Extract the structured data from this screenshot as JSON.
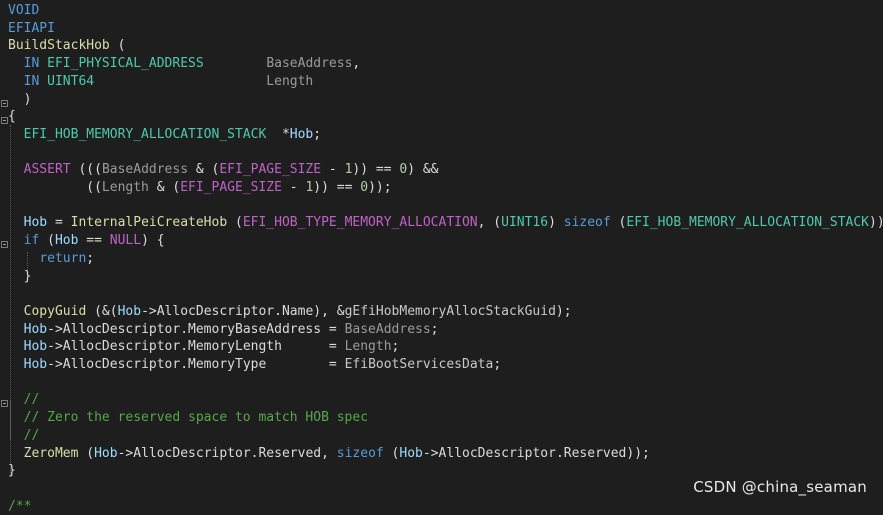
{
  "code": {
    "lines": [
      [
        [
          "VOID",
          "t-kw"
        ]
      ],
      [
        [
          "EFIAPI",
          "t-kw"
        ]
      ],
      [
        [
          "BuildStackHob",
          "t-fn"
        ],
        [
          " (",
          "t-pl"
        ]
      ],
      [
        [
          "  IN ",
          "t-kw"
        ],
        [
          "EFI_PHYSICAL_ADDRESS",
          "t-ty"
        ],
        [
          "        ",
          "t-pl"
        ],
        [
          "BaseAddress",
          "t-par"
        ],
        [
          ",",
          "t-pl"
        ]
      ],
      [
        [
          "  IN ",
          "t-kw"
        ],
        [
          "UINT64",
          "t-ty"
        ],
        [
          "                      ",
          "t-pl"
        ],
        [
          "Length",
          "t-par"
        ]
      ],
      [
        [
          "  )",
          "t-pl"
        ]
      ],
      [
        [
          "{",
          "t-pl"
        ]
      ],
      [
        [
          "  ",
          "t-pl"
        ],
        [
          "EFI_HOB_MEMORY_ALLOCATION_STACK",
          "t-ty"
        ],
        [
          "  *",
          "t-pl"
        ],
        [
          "Hob",
          "t-var"
        ],
        [
          ";",
          "t-pl"
        ]
      ],
      [
        [
          "",
          "t-pl"
        ]
      ],
      [
        [
          "  ASSERT",
          "t-mac"
        ],
        [
          " (((",
          "t-pl"
        ],
        [
          "BaseAddress",
          "t-par"
        ],
        [
          " & (",
          "t-pl"
        ],
        [
          "EFI_PAGE_SIZE",
          "t-mac"
        ],
        [
          " - ",
          "t-pl"
        ],
        [
          "1",
          "t-num"
        ],
        [
          ")) == ",
          "t-pl"
        ],
        [
          "0",
          "t-num"
        ],
        [
          ") &&",
          "t-pl"
        ]
      ],
      [
        [
          "          ((",
          "t-pl"
        ],
        [
          "Length",
          "t-par"
        ],
        [
          " & (",
          "t-pl"
        ],
        [
          "EFI_PAGE_SIZE",
          "t-mac"
        ],
        [
          " - ",
          "t-pl"
        ],
        [
          "1",
          "t-num"
        ],
        [
          ")) == ",
          "t-pl"
        ],
        [
          "0",
          "t-num"
        ],
        [
          "));",
          "t-pl"
        ]
      ],
      [
        [
          "",
          "t-pl"
        ]
      ],
      [
        [
          "  ",
          "t-pl"
        ],
        [
          "Hob",
          "t-var"
        ],
        [
          " = ",
          "t-pl"
        ],
        [
          "InternalPeiCreateHob",
          "t-fn"
        ],
        [
          " (",
          "t-pl"
        ],
        [
          "EFI_HOB_TYPE_MEMORY_ALLOCATION",
          "t-mac"
        ],
        [
          ", (",
          "t-pl"
        ],
        [
          "UINT16",
          "t-ty"
        ],
        [
          ") ",
          "t-pl"
        ],
        [
          "sizeof",
          "t-kw"
        ],
        [
          " (",
          "t-pl"
        ],
        [
          "EFI_HOB_MEMORY_ALLOCATION_STACK",
          "t-ty"
        ],
        [
          "));",
          "t-pl"
        ]
      ],
      [
        [
          "  ",
          "t-pl"
        ],
        [
          "if",
          "t-kw"
        ],
        [
          " (",
          "t-pl"
        ],
        [
          "Hob",
          "t-var"
        ],
        [
          " == ",
          "t-pl"
        ],
        [
          "NULL",
          "t-mac"
        ],
        [
          ") {",
          "t-pl"
        ]
      ],
      [
        [
          "    ",
          "t-pl"
        ],
        [
          "return",
          "t-kw"
        ],
        [
          ";",
          "t-pl"
        ]
      ],
      [
        [
          "  }",
          "t-pl"
        ]
      ],
      [
        [
          "",
          "t-pl"
        ]
      ],
      [
        [
          "  ",
          "t-pl"
        ],
        [
          "CopyGuid",
          "t-fn"
        ],
        [
          " (&(",
          "t-pl"
        ],
        [
          "Hob",
          "t-var"
        ],
        [
          "->",
          "t-pl"
        ],
        [
          "AllocDescriptor",
          "t-mem"
        ],
        [
          ".",
          "t-pl"
        ],
        [
          "Name",
          "t-mem"
        ],
        [
          "), &",
          "t-pl"
        ],
        [
          "gEfiHobMemoryAllocStackGuid",
          "t-glb"
        ],
        [
          ");",
          "t-pl"
        ]
      ],
      [
        [
          "  ",
          "t-pl"
        ],
        [
          "Hob",
          "t-var"
        ],
        [
          "->",
          "t-pl"
        ],
        [
          "AllocDescriptor",
          "t-mem"
        ],
        [
          ".",
          "t-pl"
        ],
        [
          "MemoryBaseAddress",
          "t-mem"
        ],
        [
          " = ",
          "t-pl"
        ],
        [
          "BaseAddress",
          "t-par"
        ],
        [
          ";",
          "t-pl"
        ]
      ],
      [
        [
          "  ",
          "t-pl"
        ],
        [
          "Hob",
          "t-var"
        ],
        [
          "->",
          "t-pl"
        ],
        [
          "AllocDescriptor",
          "t-mem"
        ],
        [
          ".",
          "t-pl"
        ],
        [
          "MemoryLength",
          "t-mem"
        ],
        [
          "      = ",
          "t-pl"
        ],
        [
          "Length",
          "t-par"
        ],
        [
          ";",
          "t-pl"
        ]
      ],
      [
        [
          "  ",
          "t-pl"
        ],
        [
          "Hob",
          "t-var"
        ],
        [
          "->",
          "t-pl"
        ],
        [
          "AllocDescriptor",
          "t-mem"
        ],
        [
          ".",
          "t-pl"
        ],
        [
          "MemoryType",
          "t-mem"
        ],
        [
          "        = ",
          "t-pl"
        ],
        [
          "EfiBootServicesData",
          "t-glb"
        ],
        [
          ";",
          "t-pl"
        ]
      ],
      [
        [
          "",
          "t-pl"
        ]
      ],
      [
        [
          "  //",
          "t-cm"
        ]
      ],
      [
        [
          "  // Zero the reserved space to match HOB spec",
          "t-cm"
        ]
      ],
      [
        [
          "  //",
          "t-cm"
        ]
      ],
      [
        [
          "  ",
          "t-pl"
        ],
        [
          "ZeroMem",
          "t-fn"
        ],
        [
          " (",
          "t-pl"
        ],
        [
          "Hob",
          "t-var"
        ],
        [
          "->",
          "t-pl"
        ],
        [
          "AllocDescriptor",
          "t-mem"
        ],
        [
          ".",
          "t-pl"
        ],
        [
          "Reserved",
          "t-mem"
        ],
        [
          ", ",
          "t-pl"
        ],
        [
          "sizeof",
          "t-kw"
        ],
        [
          " (",
          "t-pl"
        ],
        [
          "Hob",
          "t-var"
        ],
        [
          "->",
          "t-pl"
        ],
        [
          "AllocDescriptor",
          "t-mem"
        ],
        [
          ".",
          "t-pl"
        ],
        [
          "Reserved",
          "t-mem"
        ],
        [
          "));",
          "t-pl"
        ]
      ],
      [
        [
          "}",
          "t-pl"
        ]
      ],
      [
        [
          "",
          "t-pl"
        ]
      ],
      [
        [
          "/**",
          "t-cm"
        ]
      ]
    ]
  },
  "watermark": "CSDN @china_seaman"
}
